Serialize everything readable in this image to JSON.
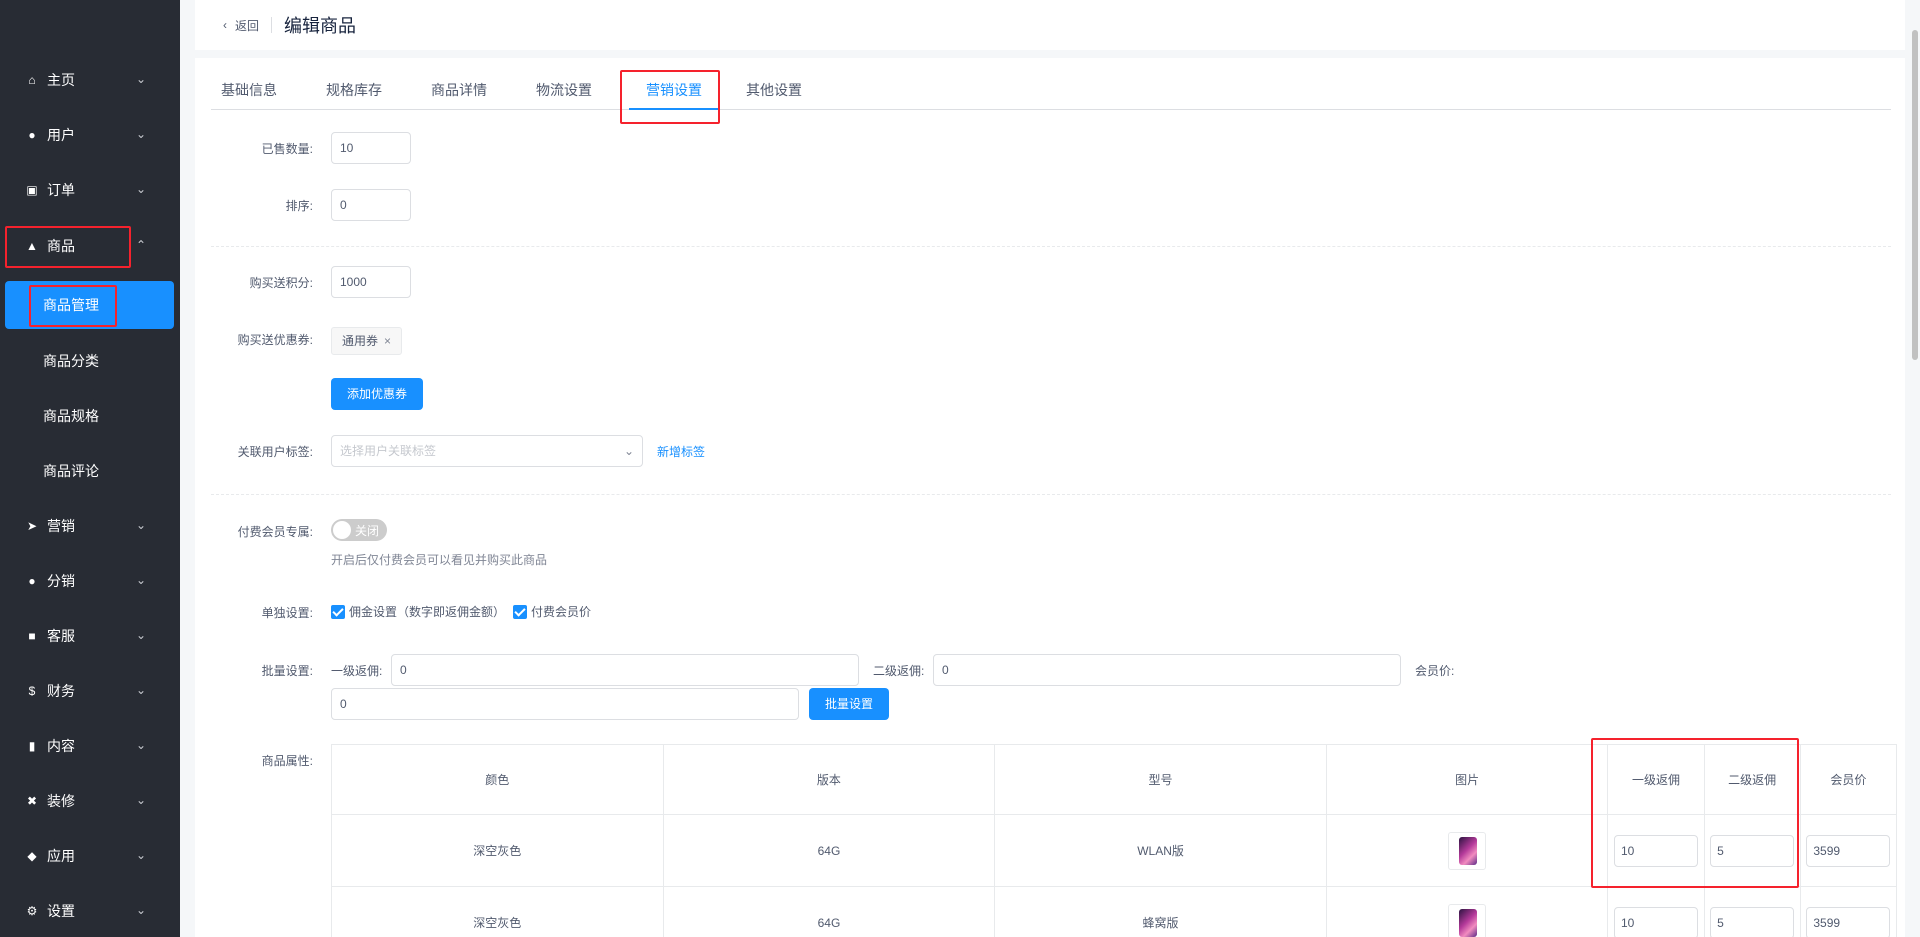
{
  "sidebar": {
    "items": [
      {
        "label": "主页",
        "icon": "home-icon"
      },
      {
        "label": "用户",
        "icon": "user-icon"
      },
      {
        "label": "订单",
        "icon": "cart-icon"
      },
      {
        "label": "商品",
        "icon": "basket-icon"
      },
      {
        "label": "营销",
        "icon": "send-icon"
      },
      {
        "label": "分销",
        "icon": "group-icon"
      },
      {
        "label": "客服",
        "icon": "chat-icon"
      },
      {
        "label": "财务",
        "icon": "dollar-icon"
      },
      {
        "label": "内容",
        "icon": "book-icon"
      },
      {
        "label": "装修",
        "icon": "tools-icon"
      },
      {
        "label": "应用",
        "icon": "box-icon"
      },
      {
        "label": "设置",
        "icon": "gear-icon"
      }
    ],
    "sub_items": [
      "商品管理",
      "商品分类",
      "商品规格",
      "商品评论"
    ]
  },
  "header": {
    "back_label": "返回",
    "title": "编辑商品"
  },
  "tabs": [
    "基础信息",
    "规格库存",
    "商品详情",
    "物流设置",
    "营销设置",
    "其他设置"
  ],
  "form": {
    "sold_label": "已售数量:",
    "sold_value": "10",
    "sort_label": "排序:",
    "sort_value": "0",
    "points_label": "购买送积分:",
    "points_value": "1000",
    "coupon_label": "购买送优惠券:",
    "coupon_tag": "通用券",
    "add_coupon_button": "添加优惠券",
    "user_tag_label": "关联用户标签:",
    "user_tag_placeholder": "选择用户关联标签",
    "new_tag_link": "新增标签",
    "paid_member_label": "付费会员专属:",
    "switch_text": "关闭",
    "paid_member_help": "开启后仅付费会员可以看见并购买此商品",
    "single_label": "单独设置:",
    "check_commission": "佣金设置（数字即返佣金额）",
    "check_member_price": "付费会员价",
    "batch_label": "批量设置:",
    "level1_label": "一级返佣:",
    "level1_value": "0",
    "level2_label": "二级返佣:",
    "level2_value": "0",
    "member_price_label": "会员价:",
    "member_price_value": "0",
    "batch_button": "批量设置",
    "attr_label": "商品属性:"
  },
  "table": {
    "headers": [
      "颜色",
      "版本",
      "型号",
      "图片",
      "一级返佣",
      "二级返佣",
      "会员价"
    ],
    "rows": [
      {
        "color": "深空灰色",
        "version": "64G",
        "model": "WLAN版",
        "level1": "10",
        "level2": "5",
        "member": "3599"
      },
      {
        "color": "深空灰色",
        "version": "64G",
        "model": "蜂窝版",
        "level1": "10",
        "level2": "5",
        "member": "3599"
      }
    ]
  },
  "colors": {
    "accent": "#1890ff",
    "sidebar_bg": "#282c34",
    "highlight": "#f5222d"
  }
}
